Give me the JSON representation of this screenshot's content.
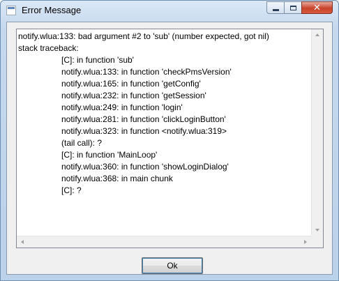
{
  "window": {
    "title": "Error Message"
  },
  "message": {
    "lines": [
      {
        "text": "notify.wlua:133: bad argument #2 to 'sub' (number expected, got nil)",
        "indent": false
      },
      {
        "text": "stack traceback:",
        "indent": false
      },
      {
        "text": "[C]: in function 'sub'",
        "indent": true
      },
      {
        "text": "notify.wlua:133: in function 'checkPmsVersion'",
        "indent": true
      },
      {
        "text": "notify.wlua:165: in function 'getConfig'",
        "indent": true
      },
      {
        "text": "notify.wlua:232: in function 'getSession'",
        "indent": true
      },
      {
        "text": "notify.wlua:249: in function 'login'",
        "indent": true
      },
      {
        "text": "notify.wlua:281: in function 'clickLoginButton'",
        "indent": true
      },
      {
        "text": "notify.wlua:323: in function <notify.wlua:319>",
        "indent": true
      },
      {
        "text": "(tail call): ?",
        "indent": true
      },
      {
        "text": "[C]: in function 'MainLoop'",
        "indent": true
      },
      {
        "text": "notify.wlua:360: in function 'showLoginDialog'",
        "indent": true
      },
      {
        "text": "notify.wlua:368: in main chunk",
        "indent": true
      },
      {
        "text": "[C]: ?",
        "indent": true
      }
    ]
  },
  "buttons": {
    "ok_label": "Ok"
  },
  "icons": {
    "app": "window-app-icon",
    "minimize": "minimize-icon",
    "maximize": "maximize-icon",
    "close": "close-icon"
  },
  "colors": {
    "close_button": "#c9442b",
    "titlebar": "#c5d8ee",
    "dialog_background": "#f0f0f0"
  }
}
